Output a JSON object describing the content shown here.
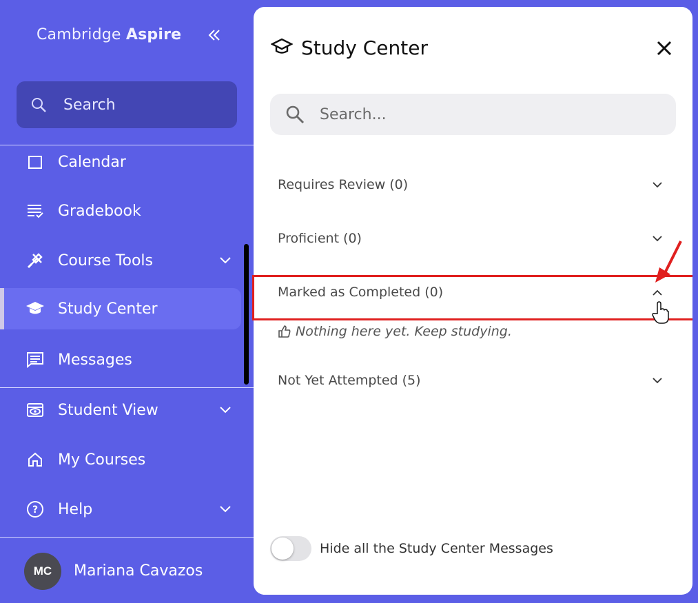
{
  "sidebar": {
    "brand_name": "Cambridge",
    "brand_product": "Aspire",
    "search_placeholder": "Search",
    "items": [
      {
        "label": "Calendar",
        "icon": "calendar-icon"
      },
      {
        "label": "Gradebook",
        "icon": "gradebook-icon"
      },
      {
        "label": "Course Tools",
        "icon": "tools-icon",
        "expandable": true
      },
      {
        "label": "Study Center",
        "icon": "graduation-cap-icon",
        "active": true
      },
      {
        "label": "Messages",
        "icon": "message-icon"
      }
    ],
    "bottom_items": [
      {
        "label": "Student View",
        "icon": "eye-icon",
        "expandable": true
      },
      {
        "label": "My Courses",
        "icon": "home-icon"
      },
      {
        "label": "Help",
        "icon": "help-icon",
        "expandable": true
      }
    ],
    "user": {
      "initials": "MC",
      "name": "Mariana Cavazos"
    }
  },
  "panel": {
    "title": "Study Center",
    "search_placeholder": "Search...",
    "sections": [
      {
        "label": "Requires Review (0)",
        "expanded": false
      },
      {
        "label": "Proficient (0)",
        "expanded": false
      },
      {
        "label": "Marked as Completed (0)",
        "expanded": true,
        "empty_message": "Nothing here yet. Keep studying."
      },
      {
        "label": "Not Yet Attempted (5)",
        "expanded": false
      }
    ],
    "toggle_label": "Hide all the Study Center Messages",
    "toggle_on": false
  },
  "colors": {
    "sidebar_bg": "#5b5ee6",
    "search_bg": "#4346b4",
    "highlight": "#e0201f"
  }
}
